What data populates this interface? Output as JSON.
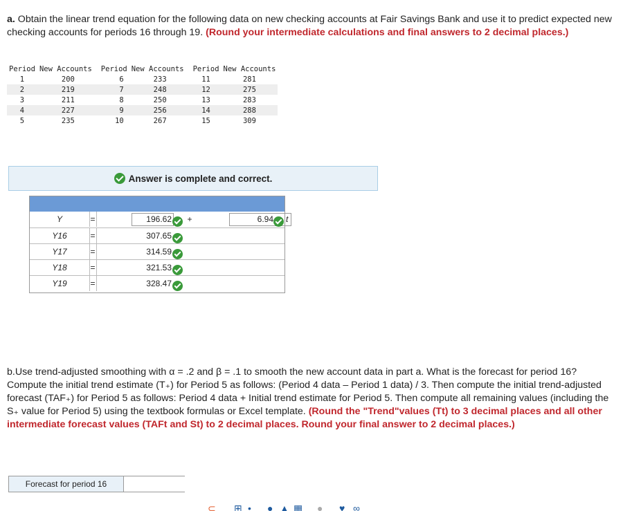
{
  "part_a": {
    "lead": "a.",
    "text": " Obtain the linear trend equation for the following data on new checking accounts at Fair Savings Bank and use it to predict expected new checking accounts for periods 16 through 19. ",
    "instruction": "(Round your intermediate calculations and final answers to 2 decimal places.)"
  },
  "data_table": {
    "headers": [
      "Period",
      "New Accounts",
      "Period",
      "New Accounts",
      "Period",
      "New Accounts"
    ],
    "rows": [
      [
        "1",
        "200",
        "6",
        "233",
        "11",
        "281"
      ],
      [
        "2",
        "219",
        "7",
        "248",
        "12",
        "275"
      ],
      [
        "3",
        "211",
        "8",
        "250",
        "13",
        "283"
      ],
      [
        "4",
        "227",
        "9",
        "256",
        "14",
        "288"
      ],
      [
        "5",
        "235",
        "10",
        "267",
        "15",
        "309"
      ]
    ]
  },
  "banner": {
    "text": "Answer is complete and correct."
  },
  "answers": {
    "y_label": "Y",
    "equals": "=",
    "intercept": "196.62",
    "plus": "+",
    "slope": "6.94",
    "t": "t",
    "rows": [
      {
        "label": "Y16",
        "value": "307.65"
      },
      {
        "label": "Y17",
        "value": "314.59"
      },
      {
        "label": "Y18",
        "value": "321.53"
      },
      {
        "label": "Y19",
        "value": "328.47"
      }
    ]
  },
  "part_b": {
    "text": "b.Use trend-adjusted smoothing with α = .2 and β = .1 to smooth the new account data in part a. What is the forecast for period 16? Compute the initial trend estimate (T₊) for Period 5 as follows: (Period 4 data – Period 1 data) / 3. Then compute the initial trend-adjusted forecast (TAF₊) for Period 5 as follows: Period 4 data + Initial trend estimate for Period 5. Then compute all remaining values (including the S₊ value for Period 5) using the textbook formulas or Excel template. ",
    "instruction": "(Round the \"Trend\"values (Tt) to 3 decimal places and all other intermediate forecast values (TAFt and St) to 2 decimal places.  Round your final answer to 2 decimal places.)"
  },
  "forecast": {
    "label": "Forecast for period 16",
    "value": ""
  }
}
